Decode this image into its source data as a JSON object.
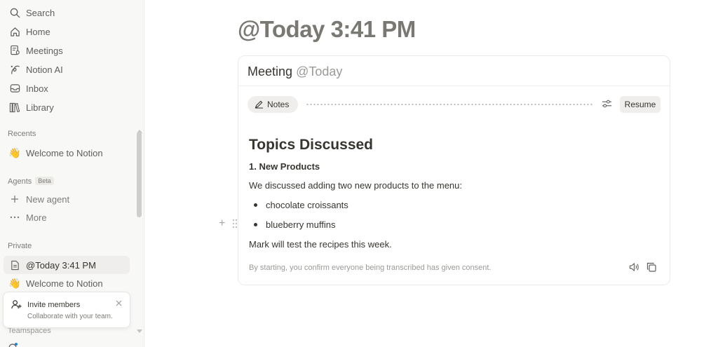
{
  "sidebar": {
    "nav": {
      "search": "Search",
      "home": "Home",
      "meetings": "Meetings",
      "notion_ai": "Notion AI",
      "inbox": "Inbox",
      "library": "Library"
    },
    "recents_label": "Recents",
    "recents": [
      "Welcome to Notion"
    ],
    "agents_label": "Agents",
    "agents_badge": "Beta",
    "new_agent": "New agent",
    "more": "More",
    "private_label": "Private",
    "private_items": [
      "@Today 3:41 PM",
      "Welcome to Notion"
    ],
    "teamspaces_label": "Teamspaces",
    "invite": {
      "title": "Invite members",
      "subtitle": "Collaborate with your team."
    }
  },
  "page": {
    "title": "@Today 3:41 PM"
  },
  "meeting": {
    "title": "Meeting",
    "date_mention": "@Today",
    "notes_tab": "Notes",
    "resume_label": "Resume",
    "heading": "Topics Discussed",
    "subheading": "1. New Products",
    "intro": "We discussed adding two new products to the menu:",
    "bullets": [
      "chocolate croissants",
      "blueberry muffins"
    ],
    "closing": "Mark will test the recipes this week.",
    "consent": "By starting, you confirm everyone being transcribed has given consent."
  },
  "colors": {
    "sidebar_bg": "#f8f8f7",
    "text": "#37352f",
    "muted": "#9b9a97",
    "title_gray": "#7a7873"
  }
}
